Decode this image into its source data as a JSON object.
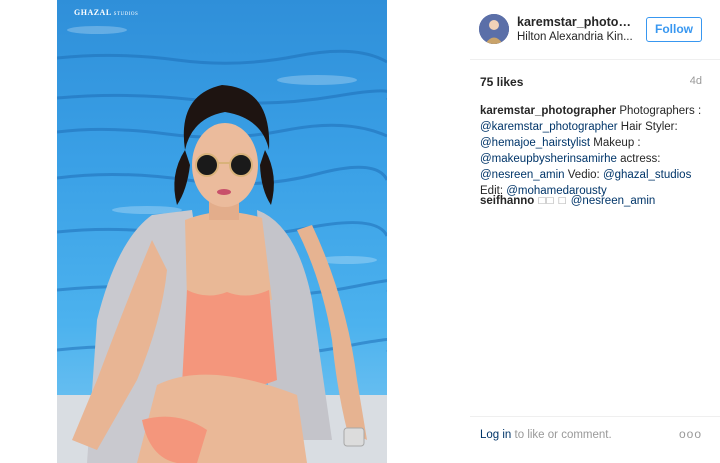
{
  "photo": {
    "watermark_main": "GHAZAL",
    "watermark_sub": "STUDIOS"
  },
  "header": {
    "username": "karemstar_photograp...",
    "location": "Hilton Alexandria Kin...",
    "follow_label": "Follow"
  },
  "stats": {
    "likes": "75 likes",
    "age": "4d"
  },
  "caption": {
    "author": "karemstar_photographer",
    "t1": " Photographers : ",
    "m1": "@karemstar_photographer",
    "t2": " Hair Styler: ",
    "m2": "@hemajoe_hairstylist",
    "t3": " Makeup : ",
    "m3": "@makeupbysherinsamirhe",
    "t4": " actress: ",
    "m4": "@nesreen_amin",
    "t5": " Vedio: ",
    "m5": "@ghazal_studios",
    "t6": " Edit: ",
    "m6": "@mohamedarousty"
  },
  "comment": {
    "author": "seifhanno",
    "glyphs": " □□ □ ",
    "mention": "@nesreen_amin"
  },
  "footer": {
    "login_link": "Log in",
    "login_text": " to like or comment.",
    "more_glyph": "ooo"
  },
  "colors": {
    "link": "#003569",
    "follow": "#3897f0",
    "pool": "#3aa0e6"
  }
}
